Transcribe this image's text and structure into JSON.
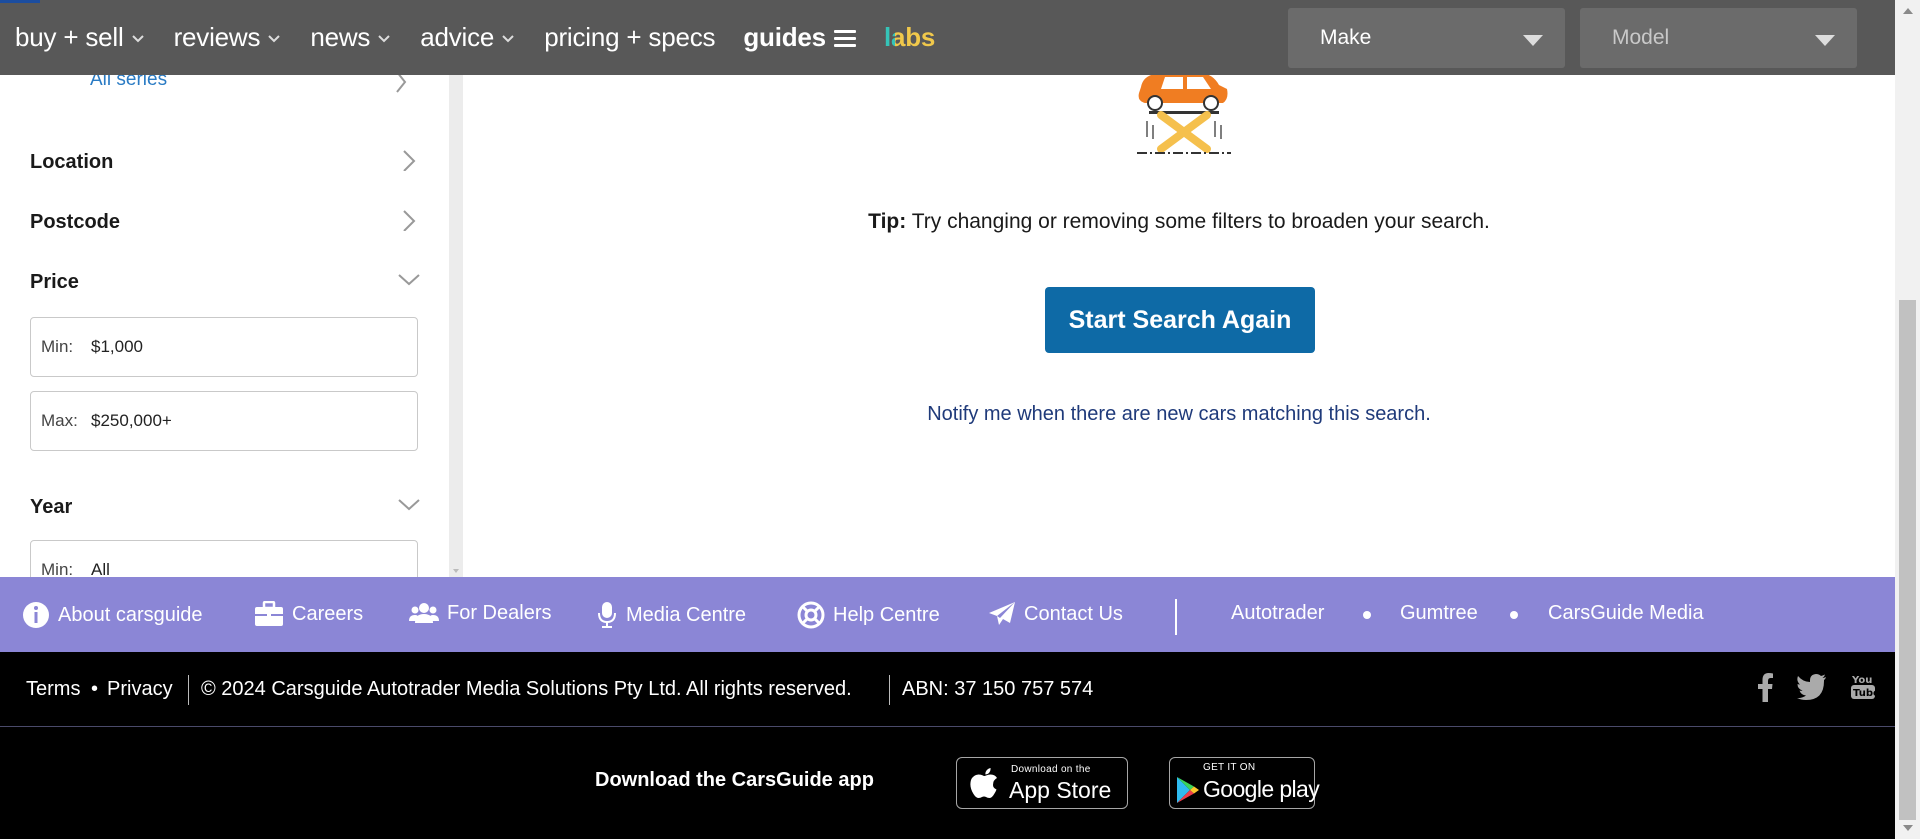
{
  "nav": {
    "items": [
      {
        "label": "buy + sell",
        "has_dropdown": true
      },
      {
        "label": "reviews",
        "has_dropdown": true
      },
      {
        "label": "news",
        "has_dropdown": true
      },
      {
        "label": "advice",
        "has_dropdown": true
      },
      {
        "label": "pricing + specs",
        "has_dropdown": false
      }
    ],
    "guides_label": "guides",
    "labs_label": "labs",
    "make_label": "Make",
    "model_label": "Model"
  },
  "sidebar": {
    "series_link": "All series",
    "location_label": "Location",
    "postcode_label": "Postcode",
    "price_label": "Price",
    "price_min_label": "Min:",
    "price_min_value": "$1,000",
    "price_max_label": "Max:",
    "price_max_value": "$250,000+",
    "year_label": "Year",
    "year_min_label": "Min:",
    "year_min_value": "All"
  },
  "main": {
    "tip_bold": "Tip:",
    "tip_text": " Try changing or removing some filters to broaden your search.",
    "start_button": "Start Search Again",
    "notify_link": "Notify me when there are new cars matching this search."
  },
  "footer_links": [
    {
      "label": "About carsguide",
      "icon": "info-icon"
    },
    {
      "label": "Careers",
      "icon": "briefcase-icon"
    },
    {
      "label": "For Dealers",
      "icon": "users-icon"
    },
    {
      "label": "Media Centre",
      "icon": "microphone-icon"
    },
    {
      "label": "Help Centre",
      "icon": "lifebuoy-icon"
    },
    {
      "label": "Contact Us",
      "icon": "paper-plane-icon"
    }
  ],
  "partner_links": [
    "Autotrader",
    "Gumtree",
    "CarsGuide Media"
  ],
  "legal": {
    "terms": "Terms",
    "bullet": "•",
    "privacy": "Privacy",
    "copyright": "© 2024 Carsguide Autotrader Media Solutions Pty Ltd. All rights reserved.",
    "abn": "ABN: 37 150 757 574",
    "socials": [
      "facebook-icon",
      "twitter-icon",
      "youtube-icon"
    ]
  },
  "app": {
    "download_text": "Download the CarsGuide app",
    "apple_small": "Download on the",
    "apple_big": "App Store",
    "google_small": "GET IT ON",
    "google_big": "Google play"
  },
  "colors": {
    "nav_bg": "#585858",
    "accent_blue": "#0e6aa6",
    "footer_purple": "#8b86d6",
    "link_blue": "#2a7bc4"
  }
}
